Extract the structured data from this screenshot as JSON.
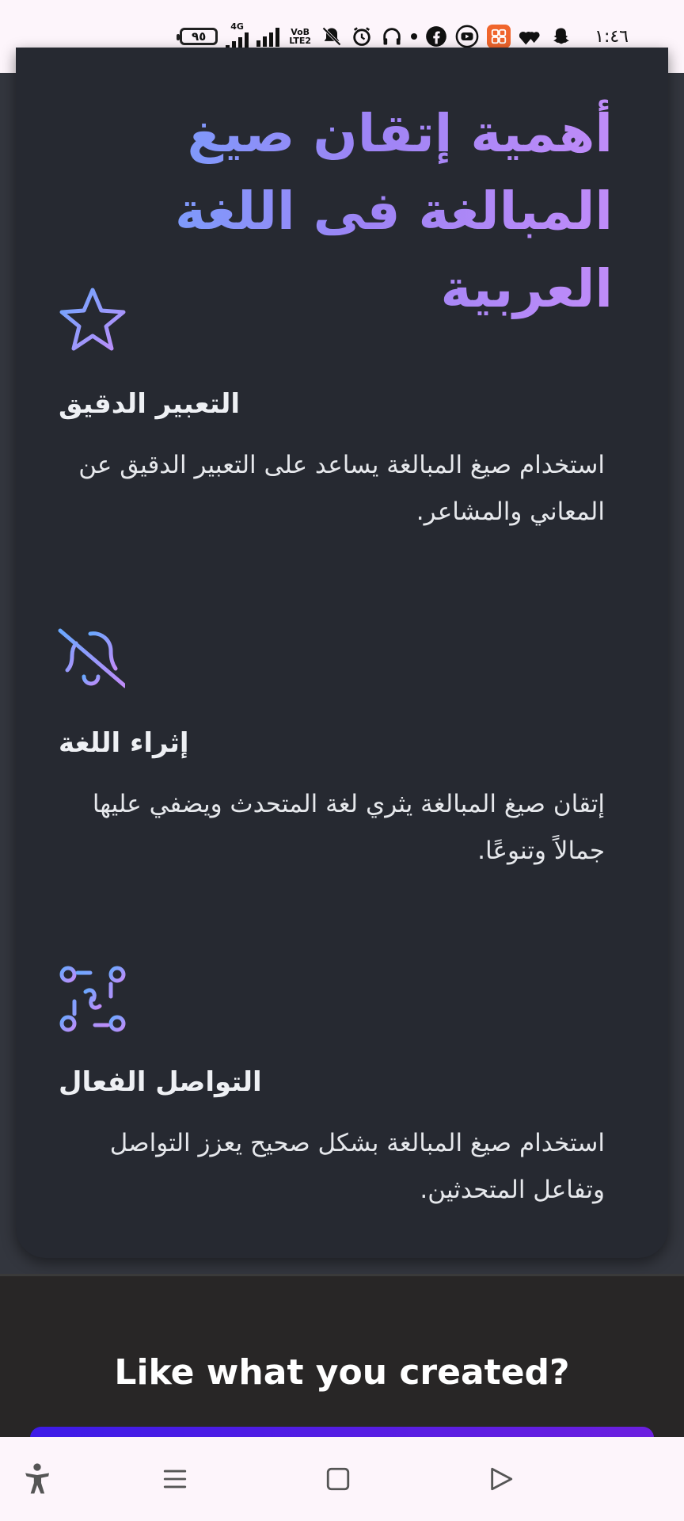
{
  "status_bar": {
    "battery": "٩٥",
    "network_4g": "4G",
    "volte_label": "VoB LTE2",
    "time": "١:٤٦",
    "icons": [
      "battery-icon",
      "signal-4g-icon",
      "signal-icon",
      "volte-icon",
      "mute-icon",
      "alarm-icon",
      "headphones-icon",
      "dot-icon",
      "facebook-icon",
      "youtube-icon",
      "app-icon",
      "hearts-icon",
      "snapchat-icon"
    ]
  },
  "main": {
    "title": "أهمية إتقان صيغ المبالغة فى اللغة العربية",
    "features": [
      {
        "icon": "star-icon",
        "heading": "التعبير الدقيق",
        "text": "استخدام صيغ المبالغة يساعد على التعبير الدقيق عن المعاني والمشاعر."
      },
      {
        "icon": "bell-off-icon",
        "heading": "إثراء اللغة",
        "text": "إتقان صيغ المبالغة يثري لغة المتحدث ويضفي عليها جمالاً وتنوعًا."
      },
      {
        "icon": "connections-icon",
        "heading": "التواصل الفعال",
        "text": "استخدام صيغ المبالغة بشكل صحيح يعزز التواصل وتفاعل المتحدثين."
      }
    ]
  },
  "cta": {
    "heading": "Like what you created?"
  },
  "nav_bar": {
    "icons": [
      "accessibility-icon",
      "recent-apps-icon",
      "home-icon",
      "back-icon"
    ]
  },
  "colors": {
    "accent_gradient_start": "#6aa8ff",
    "accent_gradient_end": "#c08cf9",
    "card_bg": "#262931",
    "cta_button": "#4a1de6"
  }
}
